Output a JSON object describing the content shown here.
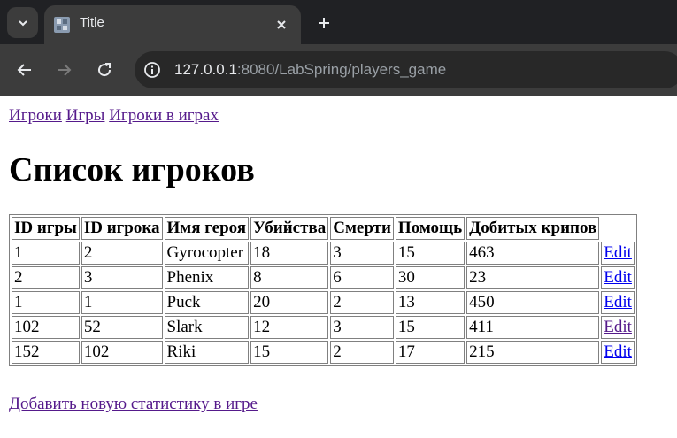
{
  "browser": {
    "tab_title": "Title",
    "url_host": "127.0.0.1",
    "url_rest": ":8080/LabSpring/players_game"
  },
  "nav": {
    "links": [
      "Игроки",
      "Игры",
      "Игроки в играх"
    ]
  },
  "page_title": "Список игроков",
  "table": {
    "headers": [
      "ID игры",
      "ID игрока",
      "Имя героя",
      "Убийства",
      "Смерти",
      "Помощь",
      "Добитых крипов"
    ],
    "rows": [
      [
        "1",
        "2",
        "Gyrocopter",
        "18",
        "3",
        "15",
        "463"
      ],
      [
        "2",
        "3",
        "Phenix",
        "8",
        "6",
        "30",
        "23"
      ],
      [
        "1",
        "1",
        "Puck",
        "20",
        "2",
        "13",
        "450"
      ],
      [
        "102",
        "52",
        "Slark",
        "12",
        "3",
        "15",
        "411"
      ],
      [
        "152",
        "102",
        "Riki",
        "15",
        "2",
        "17",
        "215"
      ]
    ],
    "edit_label": "Edit"
  },
  "add_link": "Добавить новую статистику в игре"
}
